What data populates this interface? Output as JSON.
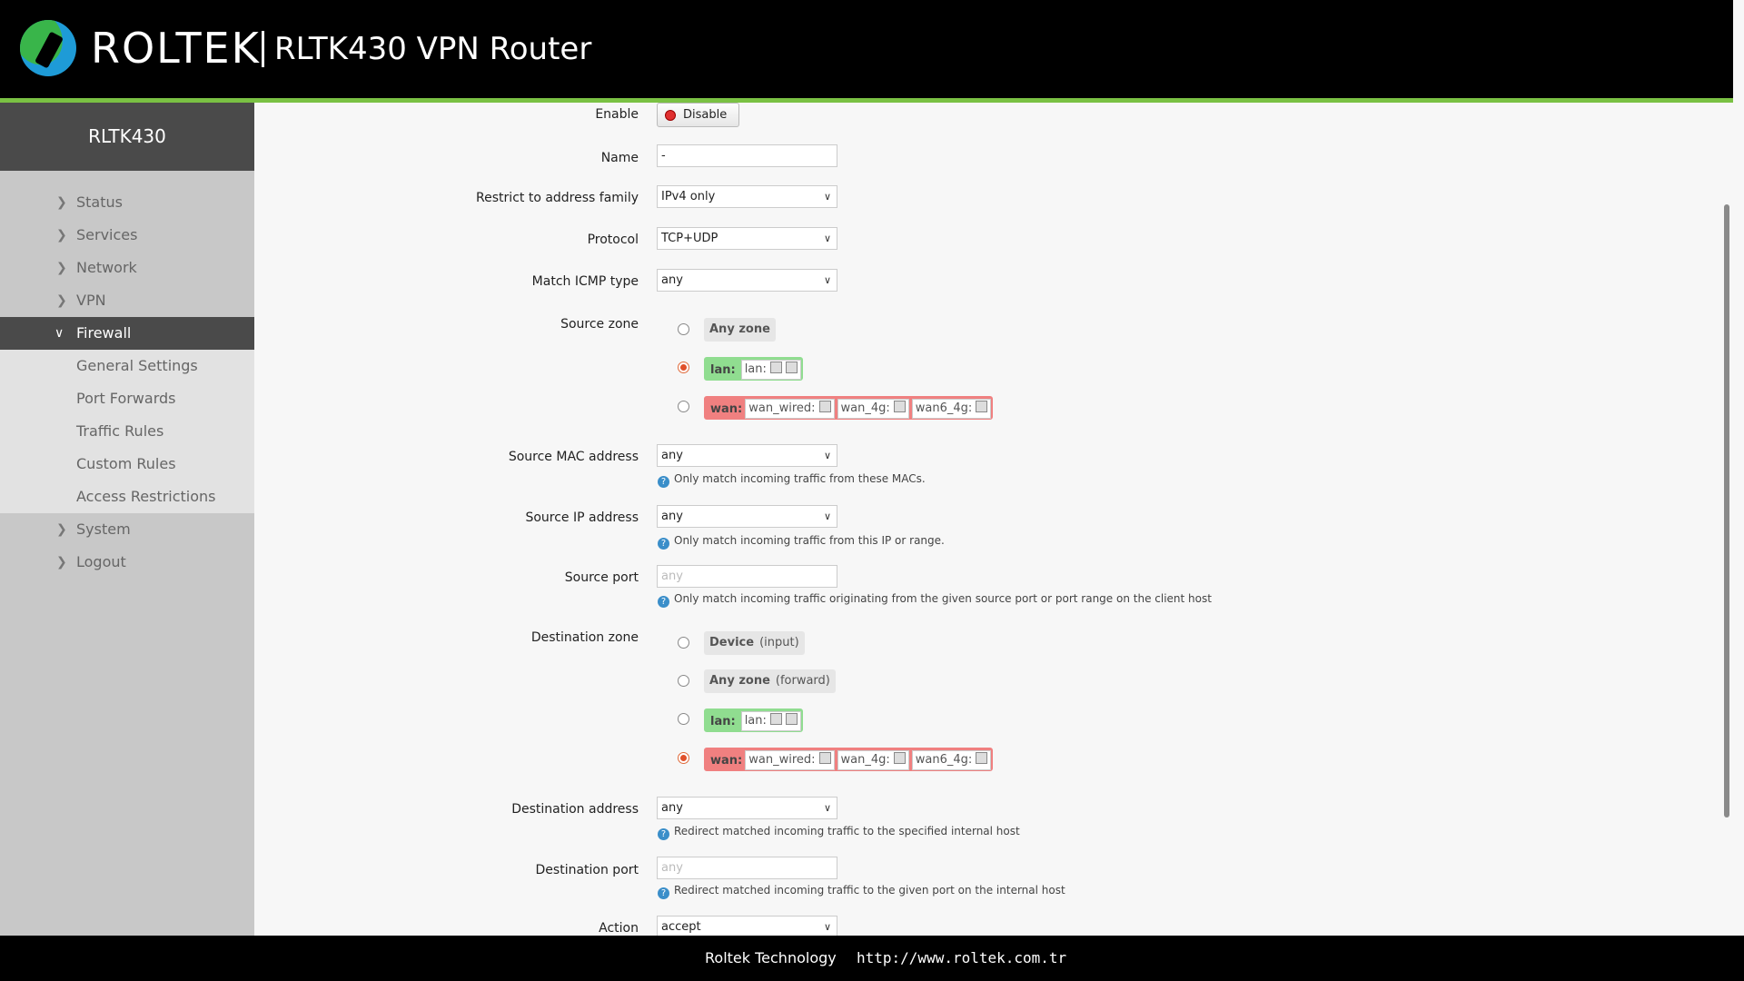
{
  "header": {
    "brand": "ROLTEK",
    "title": "RLTK430 VPN Router"
  },
  "sidebar": {
    "device": "RLTK430",
    "items": [
      {
        "label": "Status"
      },
      {
        "label": "Services"
      },
      {
        "label": "Network"
      },
      {
        "label": "VPN"
      },
      {
        "label": "Firewall"
      }
    ],
    "sub_items": [
      {
        "label": "General Settings"
      },
      {
        "label": "Port Forwards"
      },
      {
        "label": "Traffic Rules"
      },
      {
        "label": "Custom Rules"
      },
      {
        "label": "Access Restrictions"
      }
    ],
    "items_after": [
      {
        "label": "System"
      },
      {
        "label": "Logout"
      }
    ]
  },
  "form": {
    "enable": {
      "label": "Enable",
      "button": "Disable"
    },
    "name": {
      "label": "Name",
      "value": "-"
    },
    "family": {
      "label": "Restrict to address family",
      "value": "IPv4 only"
    },
    "protocol": {
      "label": "Protocol",
      "value": "TCP+UDP"
    },
    "icmp": {
      "label": "Match ICMP type",
      "value": "any"
    },
    "source_zone": {
      "label": "Source zone",
      "any_zone": "Any zone",
      "lan": {
        "name": "lan:",
        "networks": [
          "lan:"
        ]
      },
      "wan": {
        "name": "wan:",
        "networks": [
          "wan_wired:",
          "wan_4g:",
          "wan6_4g:"
        ]
      }
    },
    "source_mac": {
      "label": "Source MAC address",
      "value": "any",
      "hint": "Only match incoming traffic from these MACs."
    },
    "source_ip": {
      "label": "Source IP address",
      "value": "any",
      "hint": "Only match incoming traffic from this IP or range."
    },
    "source_port": {
      "label": "Source port",
      "placeholder": "any",
      "hint": "Only match incoming traffic originating from the given source port or port range on the client host"
    },
    "dest_zone": {
      "label": "Destination zone",
      "device": {
        "name": "Device",
        "sub": "(input)"
      },
      "any_zone": {
        "name": "Any zone",
        "sub": "(forward)"
      },
      "lan": {
        "name": "lan:",
        "networks": [
          "lan:"
        ]
      },
      "wan": {
        "name": "wan:",
        "networks": [
          "wan_wired:",
          "wan_4g:",
          "wan6_4g:"
        ]
      }
    },
    "dest_addr": {
      "label": "Destination address",
      "value": "any",
      "hint": "Redirect matched incoming traffic to the specified internal host"
    },
    "dest_port": {
      "label": "Destination port",
      "placeholder": "any",
      "hint": "Redirect matched incoming traffic to the given port on the internal host"
    },
    "action": {
      "label": "Action",
      "value": "accept"
    }
  },
  "footer": {
    "company": "Roltek Technology",
    "url": "http://www.roltek.com.tr"
  },
  "colors": {
    "accent": "#7ac143",
    "zone_lan": "#90dd90",
    "zone_wan": "#f08080",
    "sidebar_active": "#4a4a4a"
  }
}
